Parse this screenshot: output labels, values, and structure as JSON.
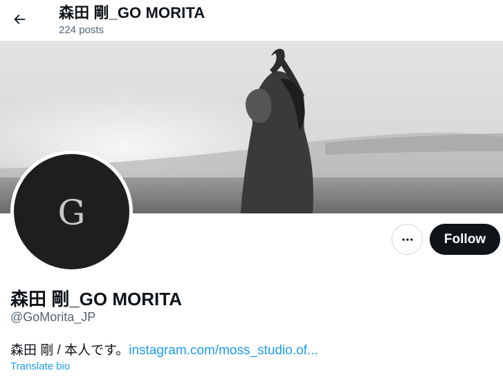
{
  "header": {
    "title": "森田 剛_GO MORITA",
    "post_count": "224 posts"
  },
  "banner": {
    "description_icon": "photo-banner"
  },
  "avatar": {
    "letter": "G"
  },
  "actions": {
    "follow_label": "Follow",
    "more_icon": "more-horizontal-icon"
  },
  "profile": {
    "display_name": "森田 剛_GO MORITA",
    "handle": "@GoMorita_JP",
    "bio_text": "森田 剛 / 本人です。",
    "bio_link": "instagram.com/moss_studio.of...",
    "translate_label": "Translate bio"
  },
  "colors": {
    "link": "#1d9bf0",
    "primary_text": "#0f1419",
    "secondary_text": "#536471",
    "follow_bg": "#0f1419"
  }
}
